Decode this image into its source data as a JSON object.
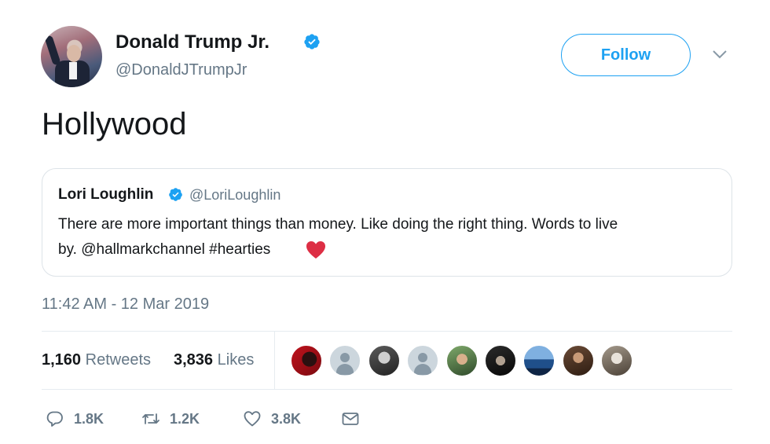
{
  "author": {
    "display_name": "Donald Trump Jr.",
    "handle": "@DonaldJTrumpJr",
    "verified": true
  },
  "follow_label": "Follow",
  "tweet_text": "Hollywood",
  "quoted_tweet": {
    "display_name": "Lori Loughlin",
    "handle": "@LoriLoughlin",
    "verified": true,
    "line1": "There are more important things than money. Like doing the right thing. Words to live",
    "line2": "by. @hallmarkchannel #hearties",
    "emoji": "red-heart"
  },
  "timestamp": "11:42 AM - 12 Mar 2019",
  "stats": {
    "retweets_count": "1,160",
    "retweets_label": "Retweets",
    "likes_count": "3,836",
    "likes_label": "Likes"
  },
  "likers": [
    {
      "style": "red-dark"
    },
    {
      "style": "default"
    },
    {
      "style": "photo-gray"
    },
    {
      "style": "default"
    },
    {
      "style": "photo-green"
    },
    {
      "style": "photo-dark"
    },
    {
      "style": "photo-blue"
    },
    {
      "style": "photo-brown"
    },
    {
      "style": "photo-light"
    }
  ],
  "actions": {
    "reply_count": "1.8K",
    "retweet_count": "1.2K",
    "like_count": "3.8K"
  },
  "colors": {
    "accent": "#1da1f2",
    "secondary_text": "#657786",
    "heart": "#e0245e"
  }
}
